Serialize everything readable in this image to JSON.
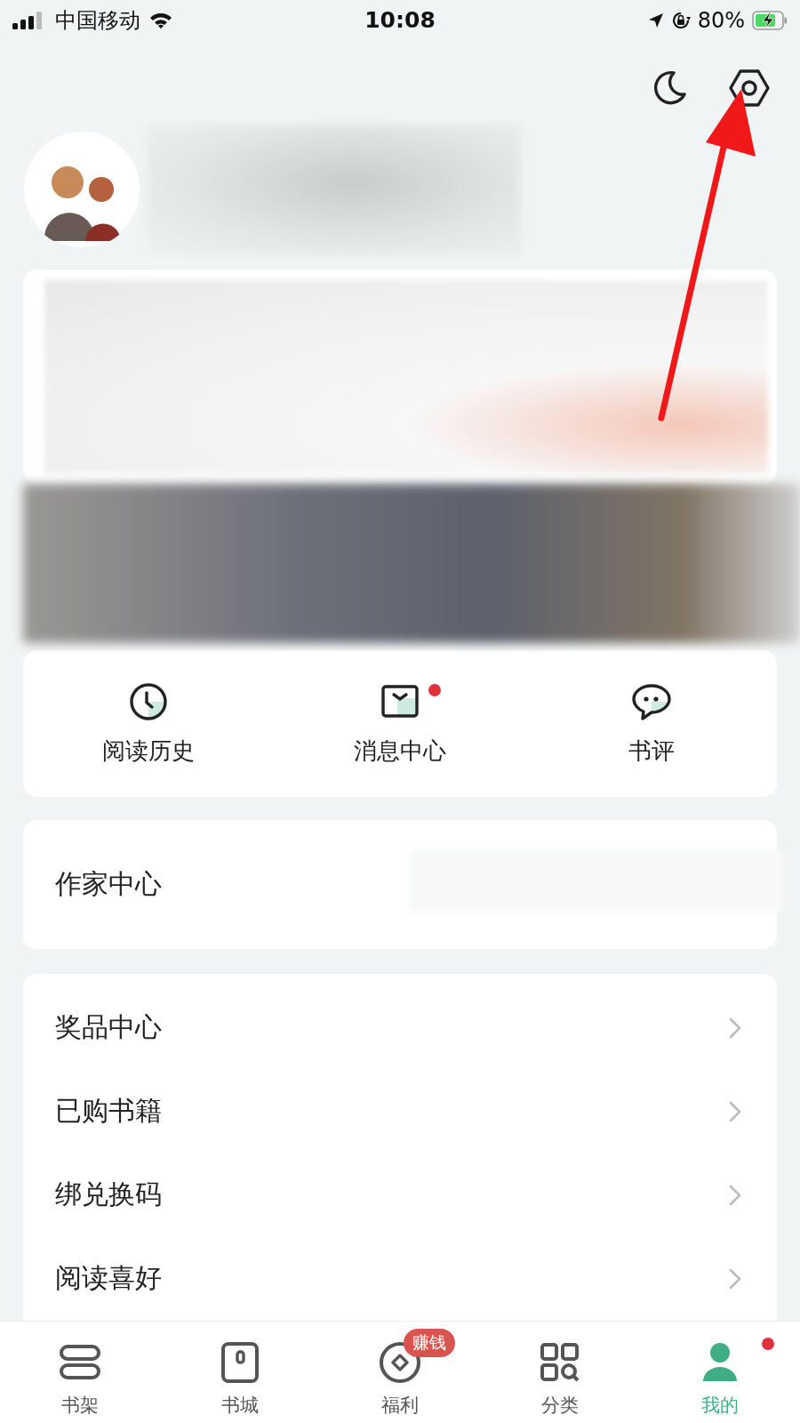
{
  "status_bar": {
    "carrier": "中国移动",
    "time": "10:08",
    "battery": "80%"
  },
  "quick_actions": [
    {
      "kind": "history",
      "label": "阅读历史",
      "dot": false
    },
    {
      "kind": "message",
      "label": "消息中心",
      "dot": true
    },
    {
      "kind": "review",
      "label": "书评",
      "dot": false
    }
  ],
  "writer_center": {
    "label": "作家中心"
  },
  "menu": [
    {
      "label": "奖品中心"
    },
    {
      "label": "已购书籍"
    },
    {
      "label": "绑兑换码"
    },
    {
      "label": "阅读喜好"
    }
  ],
  "tab_bar": [
    {
      "kind": "shelf",
      "label": "书架",
      "selected": false,
      "dot": false
    },
    {
      "kind": "store",
      "label": "书城",
      "selected": false,
      "dot": false
    },
    {
      "kind": "welfare",
      "label": "福利",
      "selected": false,
      "dot": false,
      "badge": "赚钱"
    },
    {
      "kind": "category",
      "label": "分类",
      "selected": false,
      "dot": false
    },
    {
      "kind": "profile",
      "label": "我的",
      "selected": true,
      "dot": true
    }
  ]
}
